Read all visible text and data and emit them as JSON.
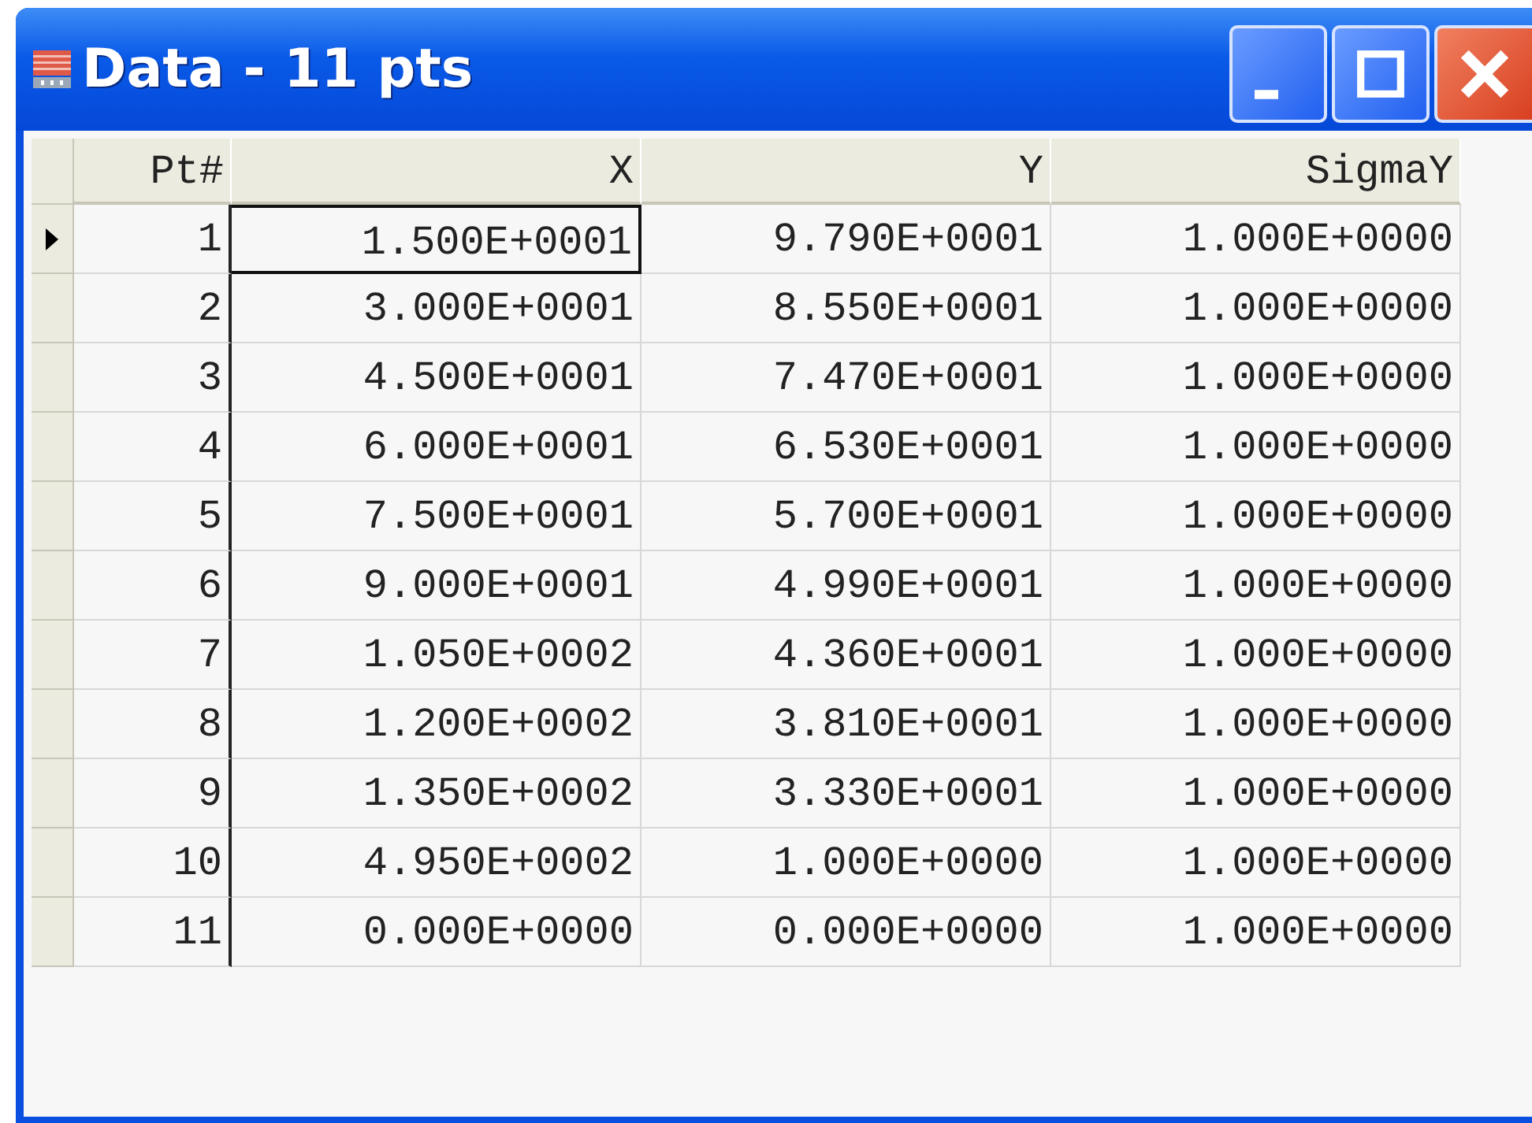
{
  "window": {
    "title": "Data - 11 pts"
  },
  "table": {
    "columns": [
      "Pt#",
      "X",
      "Y",
      "SigmaY"
    ],
    "rows": [
      {
        "selected": true,
        "cells": [
          "1",
          "1.500E+0001",
          "9.790E+0001",
          "1.000E+0000"
        ]
      },
      {
        "selected": false,
        "cells": [
          "2",
          "3.000E+0001",
          "8.550E+0001",
          "1.000E+0000"
        ]
      },
      {
        "selected": false,
        "cells": [
          "3",
          "4.500E+0001",
          "7.470E+0001",
          "1.000E+0000"
        ]
      },
      {
        "selected": false,
        "cells": [
          "4",
          "6.000E+0001",
          "6.530E+0001",
          "1.000E+0000"
        ]
      },
      {
        "selected": false,
        "cells": [
          "5",
          "7.500E+0001",
          "5.700E+0001",
          "1.000E+0000"
        ]
      },
      {
        "selected": false,
        "cells": [
          "6",
          "9.000E+0001",
          "4.990E+0001",
          "1.000E+0000"
        ]
      },
      {
        "selected": false,
        "cells": [
          "7",
          "1.050E+0002",
          "4.360E+0001",
          "1.000E+0000"
        ]
      },
      {
        "selected": false,
        "cells": [
          "8",
          "1.200E+0002",
          "3.810E+0001",
          "1.000E+0000"
        ]
      },
      {
        "selected": false,
        "cells": [
          "9",
          "1.350E+0002",
          "3.330E+0001",
          "1.000E+0000"
        ]
      },
      {
        "selected": false,
        "cells": [
          "10",
          "4.950E+0002",
          "1.000E+0000",
          "1.000E+0000"
        ]
      },
      {
        "selected": false,
        "cells": [
          "11",
          "0.000E+0000",
          "0.000E+0000",
          "1.000E+0000"
        ]
      }
    ]
  }
}
